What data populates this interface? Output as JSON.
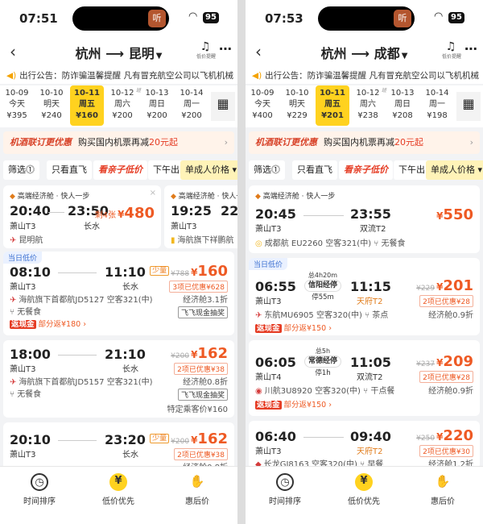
{
  "screens": [
    {
      "clock": "07:51",
      "battery": "95",
      "from": "杭州",
      "to": "昆明",
      "bell_label": "低价提醒",
      "notice": "出行公告：防诈骗温馨提醒 凡有冒充航空公司以飞机机械",
      "dates": [
        {
          "date": "10-09",
          "weekday": "今天",
          "price": "¥395",
          "tag": ""
        },
        {
          "date": "10-10",
          "weekday": "明天",
          "price": "¥240",
          "tag": ""
        },
        {
          "date": "10-11",
          "weekday": "周五",
          "price": "¥160",
          "tag": "",
          "selected": true
        },
        {
          "date": "10-12",
          "weekday": "周六",
          "price": "¥200",
          "tag": "班"
        },
        {
          "date": "10-13",
          "weekday": "周日",
          "price": "¥200",
          "tag": ""
        },
        {
          "date": "10-14",
          "weekday": "周一",
          "price": "¥200",
          "tag": ""
        }
      ],
      "promo": {
        "title": "机酒联订更优惠",
        "text_a": "购买国内机票再减",
        "amount": "20元起",
        "arrow": "›"
      },
      "filters": {
        "f1": "筛选",
        "f1_icon": "⓵",
        "f2": "只看直飞",
        "f3": "看亲子低价",
        "f4": "下午出",
        "f5": "单成人价格"
      },
      "top": {
        "a": {
          "head": "高端经济舱 · 快人一步",
          "dep": "20:40",
          "dep_ap": "萧山T3",
          "arr": "23:50",
          "arr_ap": "长水",
          "left": "剩4张",
          "price": "480",
          "airline": "昆明航"
        },
        "b": {
          "head": "高端经济舱 · 快人一步",
          "dep": "19:25",
          "dep_ap": "萧山T3",
          "arr": "22:",
          "airline": "海航旗下祥鹏航"
        }
      },
      "lowtag": "当日低价",
      "flights": [
        {
          "dep": "08:10",
          "dep_ap": "萧山T3",
          "arr": "11:10",
          "arr_ap": "长水",
          "airline": "海航旗下首都航JD5127",
          "plane": "空客321(中)",
          "meal": "无餐食",
          "shao": "少量",
          "old": "¥788",
          "price": "160",
          "disc": "3项已优惠¥628",
          "cabin": "经济舱3.1折",
          "cash": "飞飞现金抽奖",
          "rebate_tag": "返现金",
          "rebate": "部分返¥180"
        },
        {
          "dep": "18:00",
          "dep_ap": "萧山T3",
          "arr": "21:10",
          "arr_ap": "长水",
          "airline": "海航旗下首都航JD5157",
          "plane": "空客321(中)",
          "meal": "无餐食",
          "old": "¥200",
          "price": "162",
          "disc": "2项已优惠¥38",
          "cabin": "经济舱0.8折",
          "cash": "飞飞现金抽奖",
          "special": "特定乘客价¥160"
        },
        {
          "dep": "20:10",
          "dep_ap": "萧山T3",
          "arr": "23:20",
          "arr_ap": "长水",
          "shao": "少量",
          "old": "¥200",
          "price": "162",
          "disc": "2项已优惠¥38",
          "cabin": "经济舱0.8折"
        }
      ],
      "tabs": [
        "时间排序",
        "低价优先",
        "惠后价"
      ]
    },
    {
      "clock": "07:53",
      "battery": "95",
      "from": "杭州",
      "to": "成都",
      "bell_label": "低价提醒",
      "notice": "出行公告：防诈骗温馨提醒 凡有冒充航空公司以飞机机械",
      "dates": [
        {
          "date": "10-09",
          "weekday": "今天",
          "price": "¥400",
          "tag": ""
        },
        {
          "date": "10-10",
          "weekday": "明天",
          "price": "¥229",
          "tag": ""
        },
        {
          "date": "10-11",
          "weekday": "周五",
          "price": "¥201",
          "tag": "",
          "selected": true
        },
        {
          "date": "10-12",
          "weekday": "周六",
          "price": "¥238",
          "tag": "班"
        },
        {
          "date": "10-13",
          "weekday": "周日",
          "price": "¥208",
          "tag": ""
        },
        {
          "date": "10-14",
          "weekday": "周一",
          "price": "¥198",
          "tag": ""
        }
      ],
      "promo": {
        "title": "机酒联订更优惠",
        "text_a": "购买国内机票再减",
        "amount": "20元起",
        "arrow": "›"
      },
      "filters": {
        "f1": "筛选",
        "f1_icon": "⓵",
        "f2": "只看直飞",
        "f3": "看亲子低价",
        "f4": "下午出",
        "f5": "单成人价格"
      },
      "top": {
        "head": "高端经济舱 · 快人一步",
        "dep": "20:45",
        "dep_ap": "萧山T3",
        "arr": "23:55",
        "arr_ap": "双流T2",
        "price": "550",
        "airline": "成都航",
        "flightno": "EU2260",
        "plane": "空客321(中)",
        "meal": "无餐食"
      },
      "lowtag": "当日低价",
      "flights": [
        {
          "dep": "06:55",
          "dep_ap": "萧山T3",
          "arr": "11:15",
          "arr_ap": "天府T2",
          "dur": "总4h20m",
          "via": "信阳经停",
          "stay": "停55m",
          "airline": "东航MU6905",
          "plane": "空客320(中)",
          "meal": "茶点",
          "old": "¥229",
          "price": "201",
          "disc": "2项已优惠¥28",
          "cabin": "经济舱0.9折",
          "rebate_tag": "返现金",
          "rebate": "部分返¥150"
        },
        {
          "dep": "06:05",
          "dep_ap": "萧山T4",
          "arr": "11:05",
          "arr_ap": "双流T2",
          "dur": "总5h",
          "via": "常德经停",
          "stay": "停1h",
          "airline": "川航3U8920",
          "plane": "空客320(中)",
          "meal": "干点餐",
          "old": "¥237",
          "price": "209",
          "disc": "2项已优惠¥28",
          "cabin": "经济舱0.9折",
          "rebate_tag": "返现金",
          "rebate": "部分返¥150"
        },
        {
          "dep": "06:40",
          "dep_ap": "萧山T3",
          "arr": "09:40",
          "arr_ap": "天府T2",
          "airline": "长龙GJ8163",
          "plane": "空客320(中)",
          "meal": "早餐",
          "old": "¥250",
          "price": "220",
          "disc": "2项已优惠¥30",
          "cabin": "经济舱1.2折"
        }
      ],
      "tabs": [
        "时间排序",
        "低价优先",
        "惠后价"
      ]
    }
  ]
}
